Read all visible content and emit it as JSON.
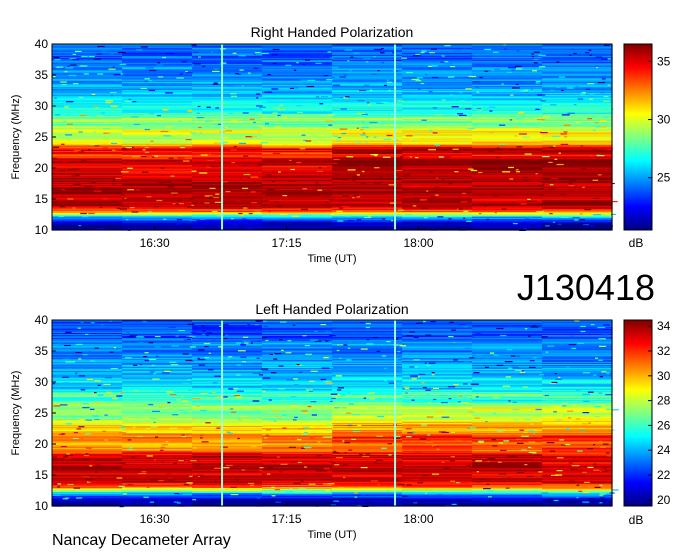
{
  "figure": {
    "id_label": "J130418",
    "footer": "Nancay Decameter Array"
  },
  "chart_data": [
    {
      "type": "heatmap",
      "title": "Right Handed Polarization",
      "xlabel": "Time (UT)",
      "ylabel": "Frequency (MHz)",
      "x_ticks": [
        "16:30",
        "17:15",
        "18:00"
      ],
      "x_tick_minutes": [
        990,
        1035,
        1080
      ],
      "xlim_minutes": [
        955,
        1146
      ],
      "y_ticks": [
        10,
        15,
        20,
        25,
        30,
        35,
        40
      ],
      "ylim": [
        10,
        40
      ],
      "colorbar": {
        "label": "dB",
        "ticks": [
          25,
          30,
          35
        ],
        "range": [
          20.5,
          36.5
        ]
      },
      "spectral_profile_db": [
        [
          10.0,
          20.5
        ],
        [
          11.0,
          21.5
        ],
        [
          12.0,
          25.0
        ],
        [
          13.0,
          33.0
        ],
        [
          14.0,
          36.0
        ],
        [
          15.0,
          35.0
        ],
        [
          16.0,
          36.0
        ],
        [
          17.0,
          35.5
        ],
        [
          18.0,
          36.0
        ],
        [
          19.0,
          35.0
        ],
        [
          20.0,
          34.5
        ],
        [
          21.0,
          36.0
        ],
        [
          22.0,
          33.0
        ],
        [
          23.0,
          35.0
        ],
        [
          24.0,
          30.0
        ],
        [
          25.0,
          29.0
        ],
        [
          26.0,
          30.5
        ],
        [
          27.0,
          28.0
        ],
        [
          28.0,
          29.0
        ],
        [
          29.0,
          26.5
        ],
        [
          30.0,
          27.0
        ],
        [
          31.0,
          26.0
        ],
        [
          32.0,
          25.5
        ],
        [
          33.0,
          25.0
        ],
        [
          34.0,
          25.0
        ],
        [
          35.0,
          24.5
        ],
        [
          36.0,
          25.0
        ],
        [
          37.0,
          24.0
        ],
        [
          38.0,
          24.0
        ],
        [
          39.0,
          24.0
        ],
        [
          40.0,
          24.5
        ]
      ],
      "time_markers_minutes": [
        1013,
        1072
      ]
    },
    {
      "type": "heatmap",
      "title": "Left Handed Polarization",
      "xlabel": "Time (UT)",
      "ylabel": "Frequency (MHz)",
      "x_ticks": [
        "16:30",
        "17:15",
        "18:00"
      ],
      "x_tick_minutes": [
        990,
        1035,
        1080
      ],
      "xlim_minutes": [
        955,
        1146
      ],
      "y_ticks": [
        10,
        15,
        20,
        25,
        30,
        35,
        40
      ],
      "ylim": [
        10,
        40
      ],
      "colorbar": {
        "label": "dB",
        "ticks": [
          20,
          22,
          24,
          26,
          28,
          30,
          32,
          34
        ],
        "range": [
          19.5,
          34.5
        ]
      },
      "spectral_profile_db": [
        [
          10.0,
          19.5
        ],
        [
          11.0,
          20.5
        ],
        [
          12.0,
          24.0
        ],
        [
          13.0,
          31.0
        ],
        [
          14.0,
          33.5
        ],
        [
          15.0,
          33.0
        ],
        [
          16.0,
          34.0
        ],
        [
          17.0,
          33.0
        ],
        [
          18.0,
          33.5
        ],
        [
          19.0,
          31.0
        ],
        [
          20.0,
          30.0
        ],
        [
          21.0,
          31.5
        ],
        [
          22.0,
          29.0
        ],
        [
          23.0,
          29.5
        ],
        [
          24.0,
          27.0
        ],
        [
          25.0,
          26.5
        ],
        [
          26.0,
          27.5
        ],
        [
          27.0,
          25.5
        ],
        [
          28.0,
          26.5
        ],
        [
          29.0,
          24.5
        ],
        [
          30.0,
          25.0
        ],
        [
          31.0,
          24.0
        ],
        [
          32.0,
          24.0
        ],
        [
          33.0,
          23.5
        ],
        [
          34.0,
          23.5
        ],
        [
          35.0,
          23.0
        ],
        [
          36.0,
          24.0
        ],
        [
          37.0,
          22.5
        ],
        [
          38.0,
          22.5
        ],
        [
          39.0,
          22.5
        ],
        [
          40.0,
          23.0
        ]
      ],
      "time_markers_minutes": [
        1013,
        1072
      ]
    }
  ]
}
